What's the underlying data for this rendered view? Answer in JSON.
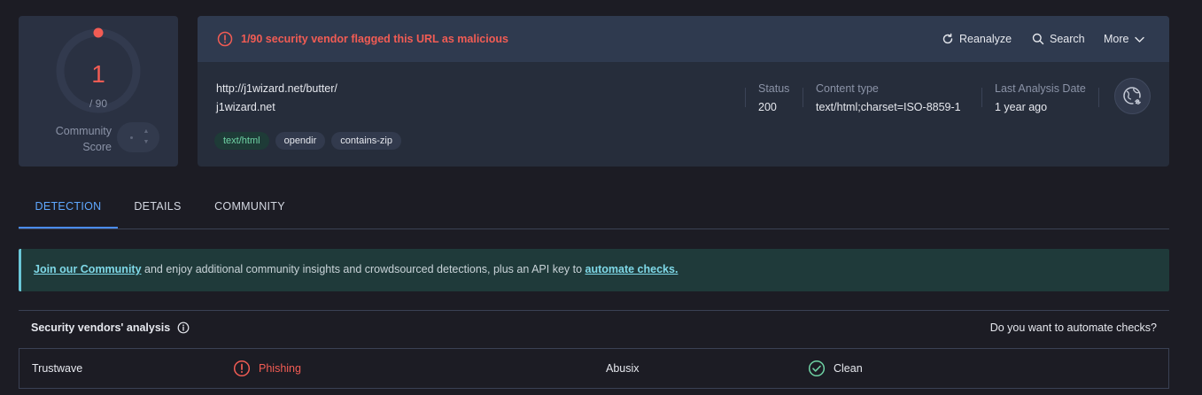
{
  "score": {
    "detections": "1",
    "total": "/ 90",
    "community_label_1": "Community",
    "community_label_2": "Score",
    "detection_fraction": 0.0111
  },
  "alert": {
    "message": "1/90 security vendor flagged this URL as malicious"
  },
  "actions": {
    "reanalyze": "Reanalyze",
    "search": "Search",
    "more": "More"
  },
  "target": {
    "url": "http://j1wizard.net/butter/",
    "domain": "j1wizard.net"
  },
  "tags": [
    "text/html",
    "opendir",
    "contains-zip"
  ],
  "meta": {
    "status_label": "Status",
    "status_value": "200",
    "content_type_label": "Content type",
    "content_type_value": "text/html;charset=ISO-8859-1",
    "last_analysis_label": "Last Analysis Date",
    "last_analysis_value": "1 year ago"
  },
  "tabs": {
    "detection": "DETECTION",
    "details": "DETAILS",
    "community": "COMMUNITY",
    "active": "DETECTION"
  },
  "banner": {
    "join_link": "Join our Community",
    "middle_text": " and enjoy additional community insights and crowdsourced detections, plus an API key to ",
    "automate_link": "automate checks."
  },
  "vendors": {
    "title": "Security vendors' analysis",
    "automate_prompt": "Do you want to automate checks?",
    "rows": [
      {
        "left_vendor": "Trustwave",
        "left_result": "Phishing",
        "right_vendor": "Abusix",
        "right_result": "Clean"
      }
    ]
  },
  "colors": {
    "malicious": "#f25c54",
    "clean": "#6fd3a5",
    "accent": "#4a8cf0",
    "background": "#1c1c24"
  },
  "icons": {
    "alert": "alert-circle-icon",
    "reanalyze": "refresh-icon",
    "search": "search-icon",
    "more": "chevron-down-icon",
    "globe": "globe-link-icon",
    "info": "info-icon",
    "phishing": "alert-circle-icon",
    "clean": "check-circle-icon"
  }
}
